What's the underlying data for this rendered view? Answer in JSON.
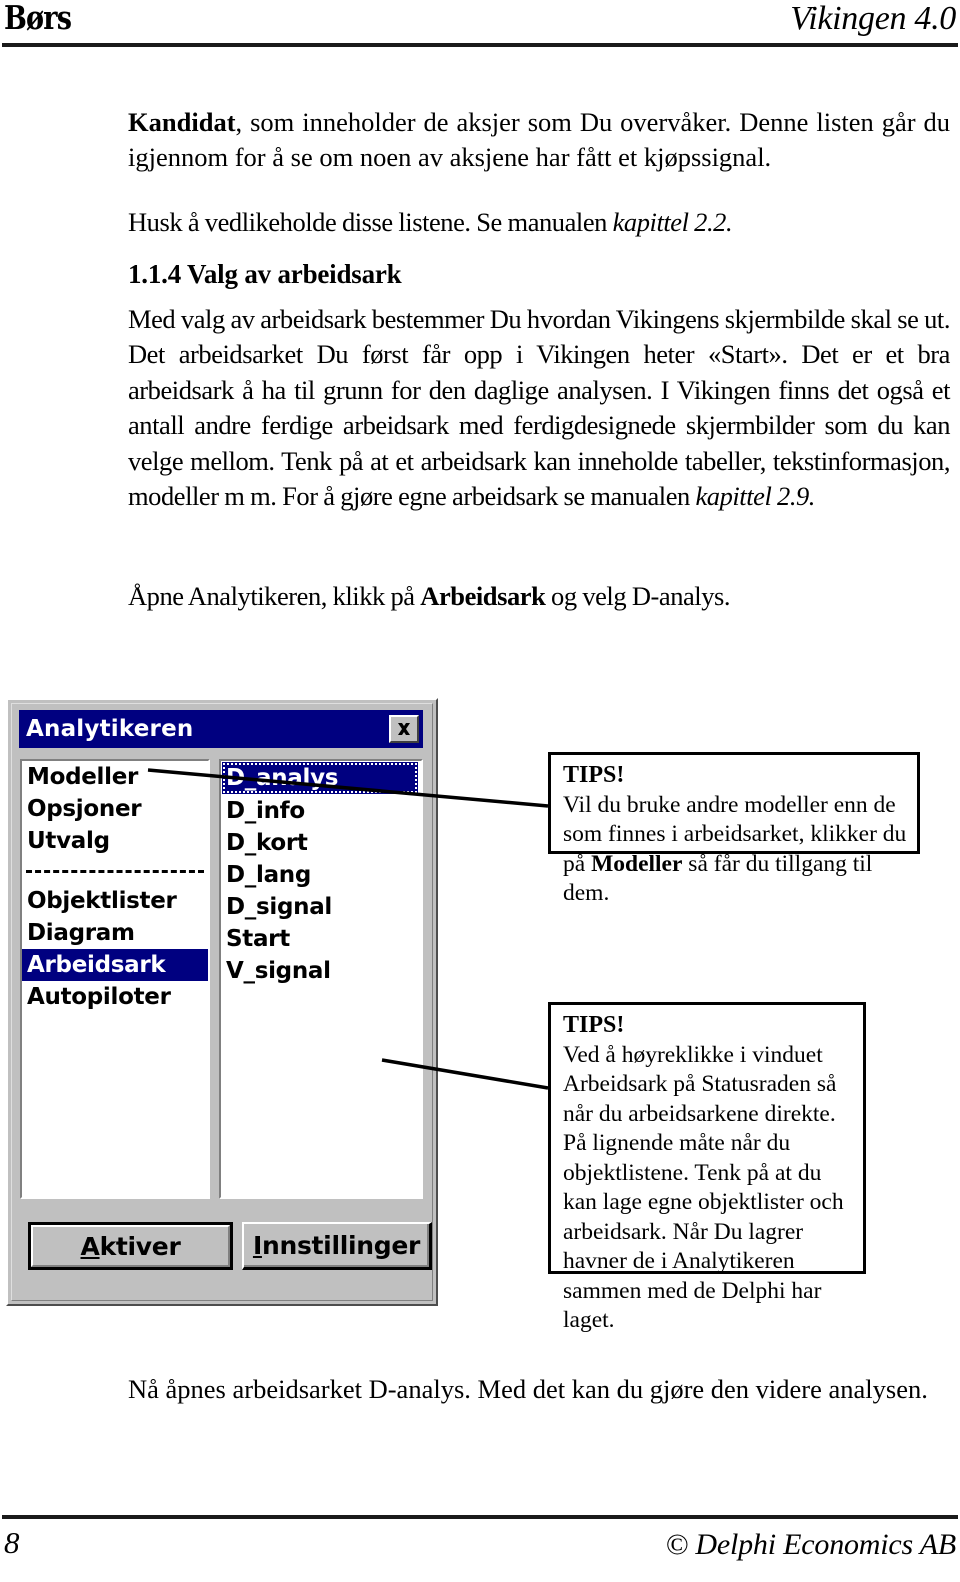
{
  "header": {
    "left_title": "Børs",
    "right_title": "Vikingen 4.0"
  },
  "content": {
    "para_kandidat_lead": "Kandidat",
    "para_kandidat_rest": ", som inneholder de aksjer som Du overvåker. Denne listen går du igjennom for å se om noen av aksjene har fått et kjøpssignal.",
    "para_husk_text": "Husk å vedlikeholde disse listene. Se manualen ",
    "para_husk_ref": "kapittel 2.2.",
    "heading_114": "1.1.4 Valg  av arbeidsark",
    "para_valg_text": "Med valg av arbeidsark bestemmer Du hvordan Vikingens skjermbilde skal se ut. Det arbeidsarket Du først får opp i Vikingen heter «Start». Det er et bra arbeidsark å ha til grunn for den daglige analysen. I Vikingen finns det også et antall andre ferdige arbeidsark med ferdigdesignede skjermbilder som du kan velge mellom. Tenk på at et arbeidsark kan inneholde tabeller, tekstinformasjon, modeller m m. For å gjøre egne arbeidsark se manualen ",
    "para_valg_ref": "kapittel 2.9.",
    "para_apne_a": "Åpne Analytikeren, klikk på ",
    "para_apne_bold": "Arbeidsark",
    "para_apne_b": " og velg D-analys.",
    "para_naa": "Nå åpnes arbeidsarket D-analys. Med det kan du gjøre den videre analysen."
  },
  "dialog": {
    "title": "Analytikeren",
    "close_icon": "close-icon",
    "categories": [
      {
        "label": "Modeller",
        "state": "normal"
      },
      {
        "label": "Opsjoner",
        "state": "normal"
      },
      {
        "label": "Utvalg",
        "state": "normal"
      },
      {
        "label": "",
        "state": "separator"
      },
      {
        "label": "Objektlister",
        "state": "normal"
      },
      {
        "label": "Diagram",
        "state": "normal"
      },
      {
        "label": "Arbeidsark",
        "state": "selected"
      },
      {
        "label": "Autopiloter",
        "state": "normal"
      }
    ],
    "sheets": [
      {
        "label": "D_analys",
        "state": "focused"
      },
      {
        "label": "D_info",
        "state": "normal"
      },
      {
        "label": "D_kort",
        "state": "normal"
      },
      {
        "label": "D_lang",
        "state": "normal"
      },
      {
        "label": "D_signal",
        "state": "normal"
      },
      {
        "label": "Start",
        "state": "normal"
      },
      {
        "label": "V_signal",
        "state": "normal"
      }
    ],
    "buttons": {
      "activate_accel": "A",
      "activate_rest": "ktiver",
      "settings_accel": "I",
      "settings_rest": "nnstillinger"
    },
    "colors": {
      "titlebar": "#000080",
      "face": "#c0c0c0",
      "selection": "#000080"
    }
  },
  "tips": [
    {
      "title": "TIPS!",
      "body_a": "Vil du bruke andre modeller enn de som finnes i arbeidsarket, klikker du på ",
      "body_bold": "Modeller",
      "body_b": " så får du tillgang til dem."
    },
    {
      "title": "TIPS!",
      "body_a": "Ved å høyreklikke i vinduet Arbeidsark på Statusraden så når du arbeidsarkene direkte. På lignende måte når du objektlistene. Tenk på at du kan lage egne objektlister och arbeidsark. Når Du lagrer havner de i Analytikeren sammen med de Delphi har laget.",
      "body_bold": "",
      "body_b": ""
    }
  ],
  "footer": {
    "page_number": "8",
    "copyright": "© Delphi Economics AB"
  }
}
